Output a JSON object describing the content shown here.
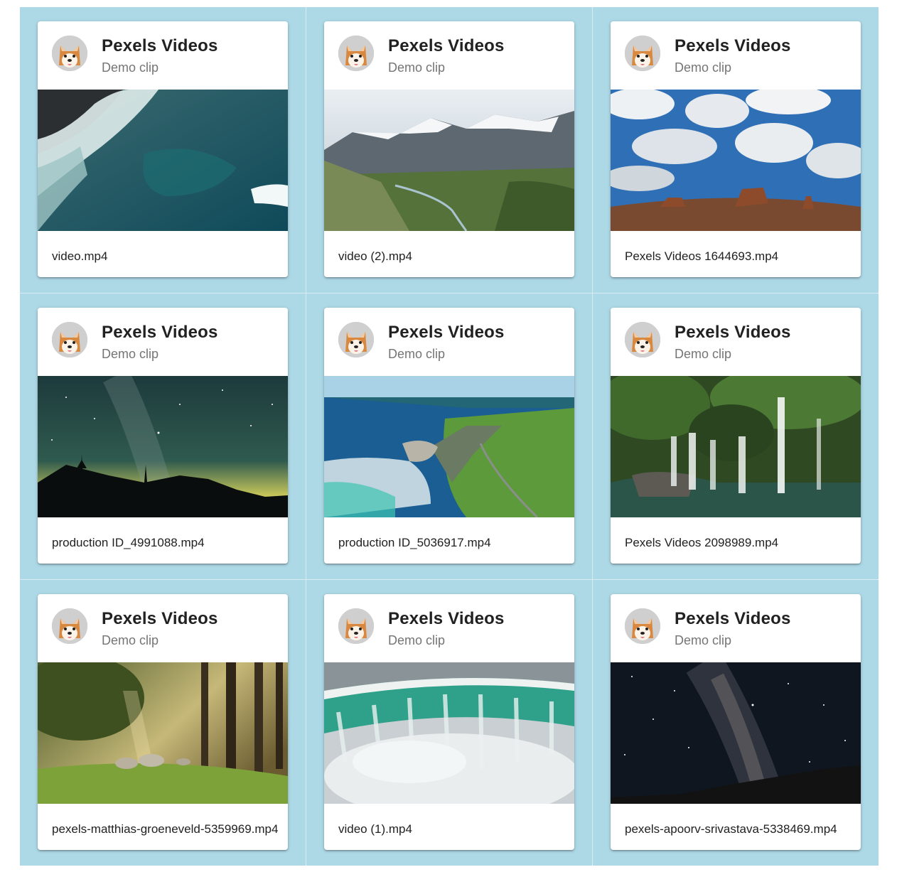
{
  "channel": {
    "title": "Pexels Videos",
    "subtitle": "Demo clip",
    "avatar_icon": "shiba-dog-avatar-icon"
  },
  "colors": {
    "background": "#add8e6",
    "card": "#ffffff",
    "title_text": "#212121",
    "subtitle_text": "#757575"
  },
  "videos": [
    {
      "filename": "video.mp4",
      "thumbnail": "aerial-ocean-waves-rocks"
    },
    {
      "filename": "video (2).mp4",
      "thumbnail": "snowy-mountain-valley-river"
    },
    {
      "filename": "Pexels Videos 1644693.mp4",
      "thumbnail": "desert-buttes-cloudy-sky"
    },
    {
      "filename": "production ID_4991088.mp4",
      "thumbnail": "milky-way-night-sky-trees"
    },
    {
      "filename": "production ID_5036917.mp4",
      "thumbnail": "coastal-cliffs-green-fields"
    },
    {
      "filename": "Pexels Videos 2098989.mp4",
      "thumbnail": "forest-waterfall-pool"
    },
    {
      "filename": "pexels-matthias-groeneveld-5359969.mp4",
      "thumbnail": "sunlit-forest-sheep"
    },
    {
      "filename": "video (1).mp4",
      "thumbnail": "horseshoe-waterfall-mist"
    },
    {
      "filename": "pexels-apoorv-srivastava-5338469.mp4",
      "thumbnail": "starry-milky-way-sky"
    }
  ]
}
